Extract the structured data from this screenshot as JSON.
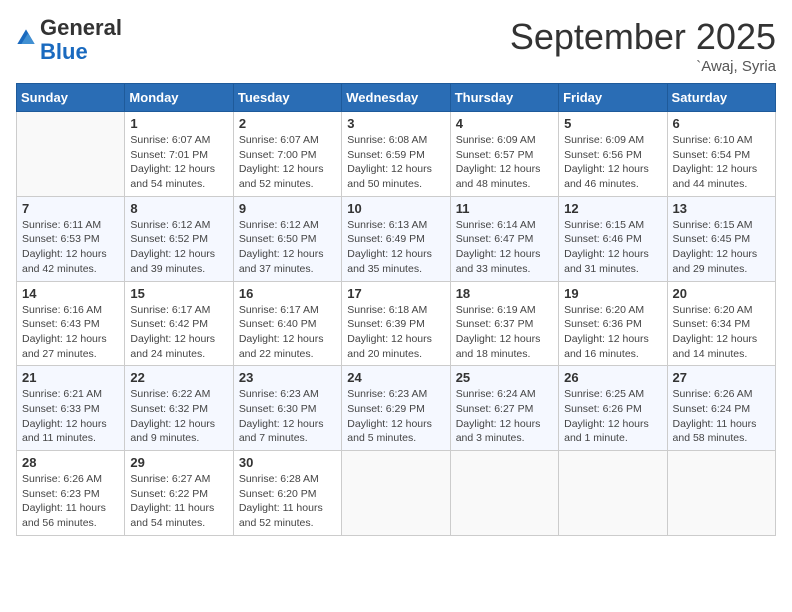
{
  "header": {
    "logo_general": "General",
    "logo_blue": "Blue",
    "month_title": "September 2025",
    "location": "`Awaj, Syria"
  },
  "days_of_week": [
    "Sunday",
    "Monday",
    "Tuesday",
    "Wednesday",
    "Thursday",
    "Friday",
    "Saturday"
  ],
  "weeks": [
    [
      {
        "day": "",
        "info": ""
      },
      {
        "day": "1",
        "info": "Sunrise: 6:07 AM\nSunset: 7:01 PM\nDaylight: 12 hours\nand 54 minutes."
      },
      {
        "day": "2",
        "info": "Sunrise: 6:07 AM\nSunset: 7:00 PM\nDaylight: 12 hours\nand 52 minutes."
      },
      {
        "day": "3",
        "info": "Sunrise: 6:08 AM\nSunset: 6:59 PM\nDaylight: 12 hours\nand 50 minutes."
      },
      {
        "day": "4",
        "info": "Sunrise: 6:09 AM\nSunset: 6:57 PM\nDaylight: 12 hours\nand 48 minutes."
      },
      {
        "day": "5",
        "info": "Sunrise: 6:09 AM\nSunset: 6:56 PM\nDaylight: 12 hours\nand 46 minutes."
      },
      {
        "day": "6",
        "info": "Sunrise: 6:10 AM\nSunset: 6:54 PM\nDaylight: 12 hours\nand 44 minutes."
      }
    ],
    [
      {
        "day": "7",
        "info": "Sunrise: 6:11 AM\nSunset: 6:53 PM\nDaylight: 12 hours\nand 42 minutes."
      },
      {
        "day": "8",
        "info": "Sunrise: 6:12 AM\nSunset: 6:52 PM\nDaylight: 12 hours\nand 39 minutes."
      },
      {
        "day": "9",
        "info": "Sunrise: 6:12 AM\nSunset: 6:50 PM\nDaylight: 12 hours\nand 37 minutes."
      },
      {
        "day": "10",
        "info": "Sunrise: 6:13 AM\nSunset: 6:49 PM\nDaylight: 12 hours\nand 35 minutes."
      },
      {
        "day": "11",
        "info": "Sunrise: 6:14 AM\nSunset: 6:47 PM\nDaylight: 12 hours\nand 33 minutes."
      },
      {
        "day": "12",
        "info": "Sunrise: 6:15 AM\nSunset: 6:46 PM\nDaylight: 12 hours\nand 31 minutes."
      },
      {
        "day": "13",
        "info": "Sunrise: 6:15 AM\nSunset: 6:45 PM\nDaylight: 12 hours\nand 29 minutes."
      }
    ],
    [
      {
        "day": "14",
        "info": "Sunrise: 6:16 AM\nSunset: 6:43 PM\nDaylight: 12 hours\nand 27 minutes."
      },
      {
        "day": "15",
        "info": "Sunrise: 6:17 AM\nSunset: 6:42 PM\nDaylight: 12 hours\nand 24 minutes."
      },
      {
        "day": "16",
        "info": "Sunrise: 6:17 AM\nSunset: 6:40 PM\nDaylight: 12 hours\nand 22 minutes."
      },
      {
        "day": "17",
        "info": "Sunrise: 6:18 AM\nSunset: 6:39 PM\nDaylight: 12 hours\nand 20 minutes."
      },
      {
        "day": "18",
        "info": "Sunrise: 6:19 AM\nSunset: 6:37 PM\nDaylight: 12 hours\nand 18 minutes."
      },
      {
        "day": "19",
        "info": "Sunrise: 6:20 AM\nSunset: 6:36 PM\nDaylight: 12 hours\nand 16 minutes."
      },
      {
        "day": "20",
        "info": "Sunrise: 6:20 AM\nSunset: 6:34 PM\nDaylight: 12 hours\nand 14 minutes."
      }
    ],
    [
      {
        "day": "21",
        "info": "Sunrise: 6:21 AM\nSunset: 6:33 PM\nDaylight: 12 hours\nand 11 minutes."
      },
      {
        "day": "22",
        "info": "Sunrise: 6:22 AM\nSunset: 6:32 PM\nDaylight: 12 hours\nand 9 minutes."
      },
      {
        "day": "23",
        "info": "Sunrise: 6:23 AM\nSunset: 6:30 PM\nDaylight: 12 hours\nand 7 minutes."
      },
      {
        "day": "24",
        "info": "Sunrise: 6:23 AM\nSunset: 6:29 PM\nDaylight: 12 hours\nand 5 minutes."
      },
      {
        "day": "25",
        "info": "Sunrise: 6:24 AM\nSunset: 6:27 PM\nDaylight: 12 hours\nand 3 minutes."
      },
      {
        "day": "26",
        "info": "Sunrise: 6:25 AM\nSunset: 6:26 PM\nDaylight: 12 hours\nand 1 minute."
      },
      {
        "day": "27",
        "info": "Sunrise: 6:26 AM\nSunset: 6:24 PM\nDaylight: 11 hours\nand 58 minutes."
      }
    ],
    [
      {
        "day": "28",
        "info": "Sunrise: 6:26 AM\nSunset: 6:23 PM\nDaylight: 11 hours\nand 56 minutes."
      },
      {
        "day": "29",
        "info": "Sunrise: 6:27 AM\nSunset: 6:22 PM\nDaylight: 11 hours\nand 54 minutes."
      },
      {
        "day": "30",
        "info": "Sunrise: 6:28 AM\nSunset: 6:20 PM\nDaylight: 11 hours\nand 52 minutes."
      },
      {
        "day": "",
        "info": ""
      },
      {
        "day": "",
        "info": ""
      },
      {
        "day": "",
        "info": ""
      },
      {
        "day": "",
        "info": ""
      }
    ]
  ]
}
